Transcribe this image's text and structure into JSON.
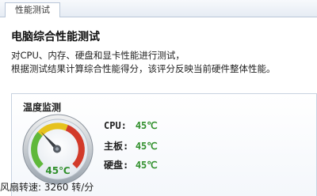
{
  "tab": {
    "label": "性能测试"
  },
  "header": {
    "title": "电脑综合性能测试",
    "line1": "对CPU、内存、硬盘和显卡性能进行测试，",
    "line2": "根据测试结果计算综合性能得分，该评分反映当前硬件整体性能。"
  },
  "temperature": {
    "title": "温度监测",
    "gauge_value": "45℃",
    "readings": [
      {
        "label": "CPU:",
        "value": "45℃"
      },
      {
        "label": "主板:",
        "value": "45℃"
      },
      {
        "label": "硬盘:",
        "value": "45℃"
      }
    ]
  },
  "fan": {
    "text": "风扇转速: 3260 转/分"
  },
  "colors": {
    "green": "#2f8f2a",
    "gauge_green": "#5fb83a",
    "gauge_yellow": "#e6c21c",
    "gauge_red": "#d23a2a"
  }
}
